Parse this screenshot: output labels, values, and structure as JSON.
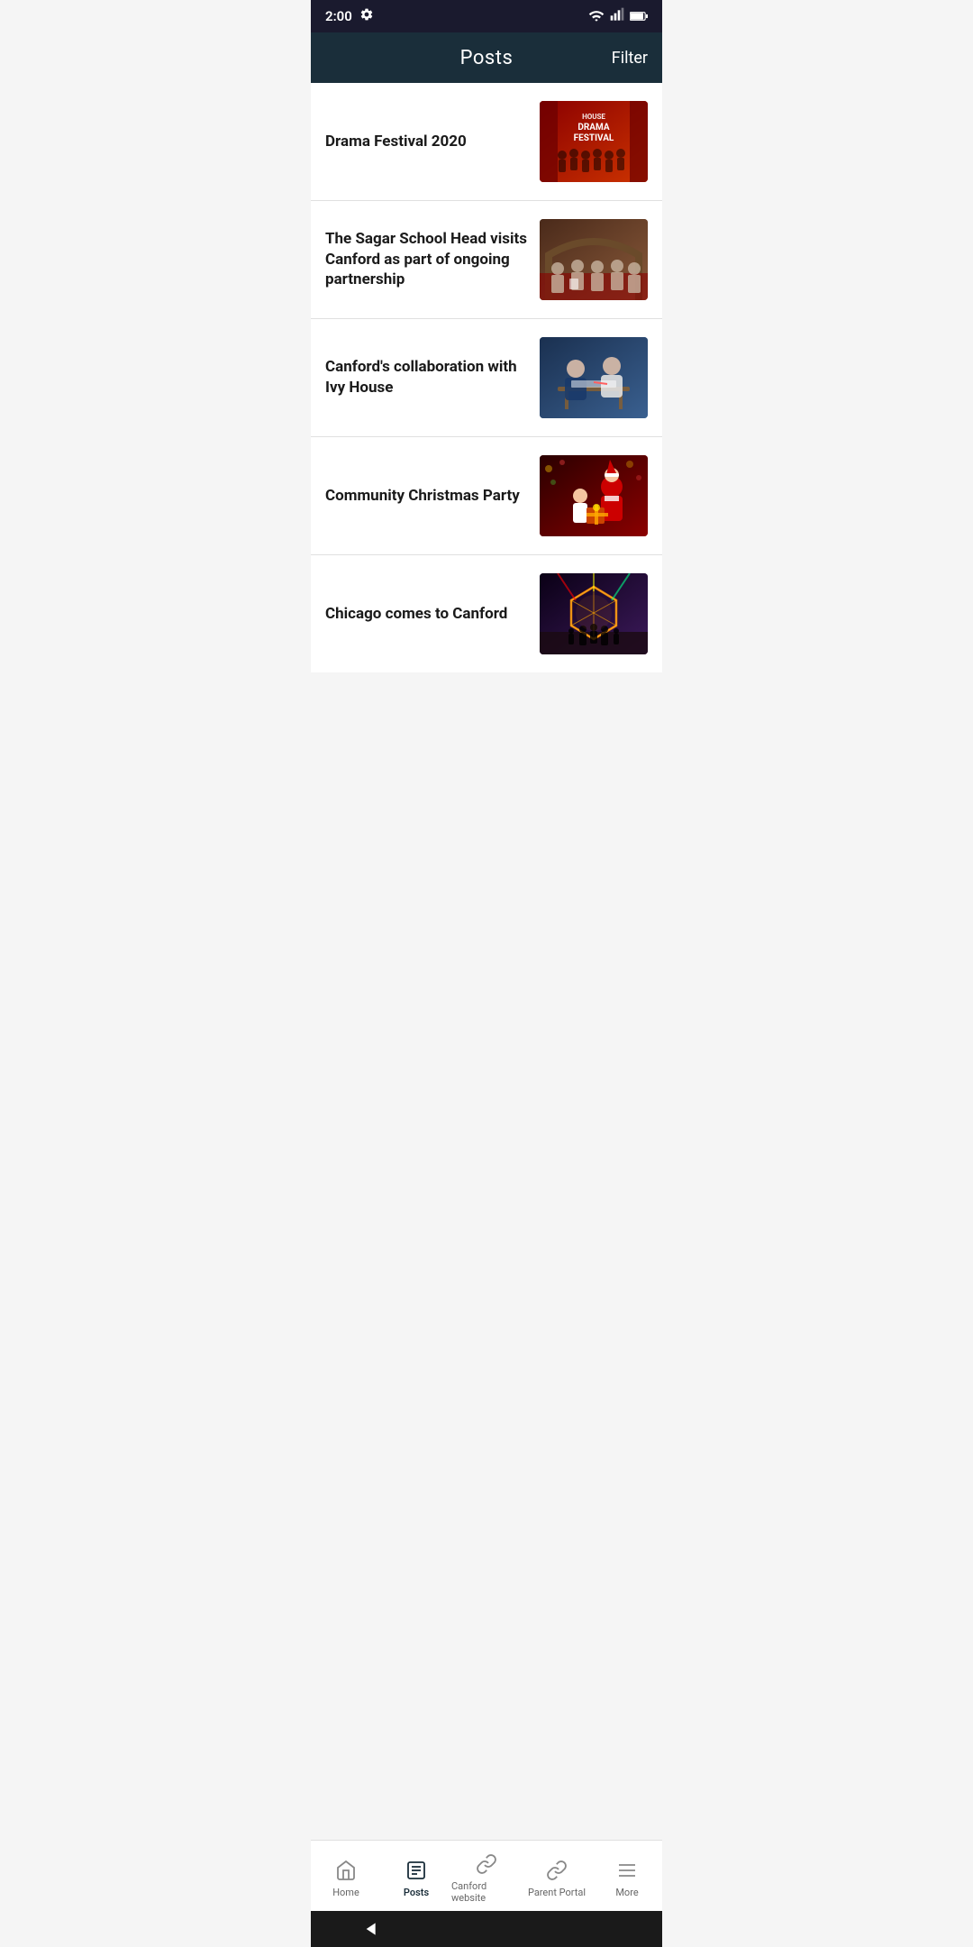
{
  "statusBar": {
    "time": "2:00",
    "gearLabel": "settings",
    "wifiLabel": "wifi",
    "signalLabel": "signal",
    "batteryLabel": "battery"
  },
  "header": {
    "title": "Posts",
    "filterLabel": "Filter"
  },
  "posts": [
    {
      "id": 1,
      "title": "Drama Festival 2020",
      "thumbType": "drama",
      "thumbAlt": "Drama Festival 2020 group photo"
    },
    {
      "id": 2,
      "title": "The Sagar School Head visits Canford as part of ongoing partnership",
      "thumbType": "sagar",
      "thumbAlt": "Sagar School Head visit photo"
    },
    {
      "id": 3,
      "title": "Canford's collaboration with Ivy House",
      "thumbType": "ivy",
      "thumbAlt": "Canford Ivy House collaboration photo"
    },
    {
      "id": 4,
      "title": "Community Christmas Party",
      "thumbType": "christmas",
      "thumbAlt": "Community Christmas Party photo"
    },
    {
      "id": 5,
      "title": "Chicago comes to Canford",
      "thumbType": "chicago",
      "thumbAlt": "Chicago musical at Canford photo"
    }
  ],
  "bottomNav": {
    "items": [
      {
        "id": "home",
        "label": "Home",
        "active": false
      },
      {
        "id": "posts",
        "label": "Posts",
        "active": true
      },
      {
        "id": "canford-website",
        "label": "Canford website",
        "active": false
      },
      {
        "id": "parent-portal",
        "label": "Parent Portal",
        "active": false
      },
      {
        "id": "more",
        "label": "More",
        "active": false
      }
    ]
  }
}
